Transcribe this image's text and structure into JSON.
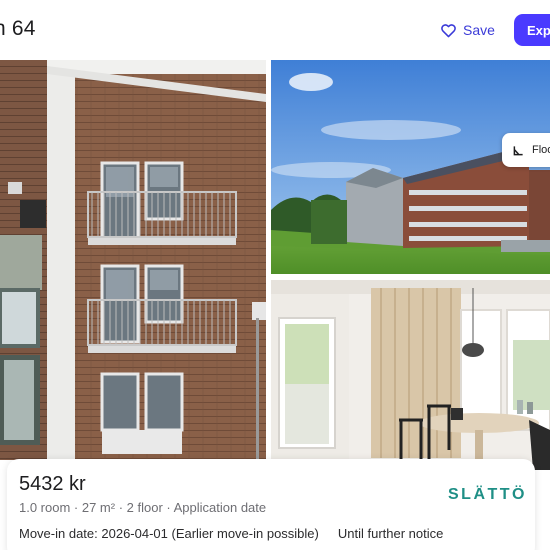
{
  "header": {
    "title": "n 64",
    "save_label": "Save",
    "primary_label": "Exp"
  },
  "gallery": {
    "floorplan_label": "Floo"
  },
  "listing": {
    "price": "5432 kr",
    "details": "1.0 room · 27 m² · 2 floor · Application date",
    "move_in": "Move-in date: 2026-04-01 (Earlier move-in possible)",
    "availability": "Until further notice",
    "brand": "SLÄTTÖ"
  },
  "colors": {
    "accent": "#4a3aff",
    "link": "#3b3bd8",
    "brand": "#1f8f86"
  },
  "icons": {
    "save": "heart-icon",
    "floorplan": "floorplan-icon"
  }
}
